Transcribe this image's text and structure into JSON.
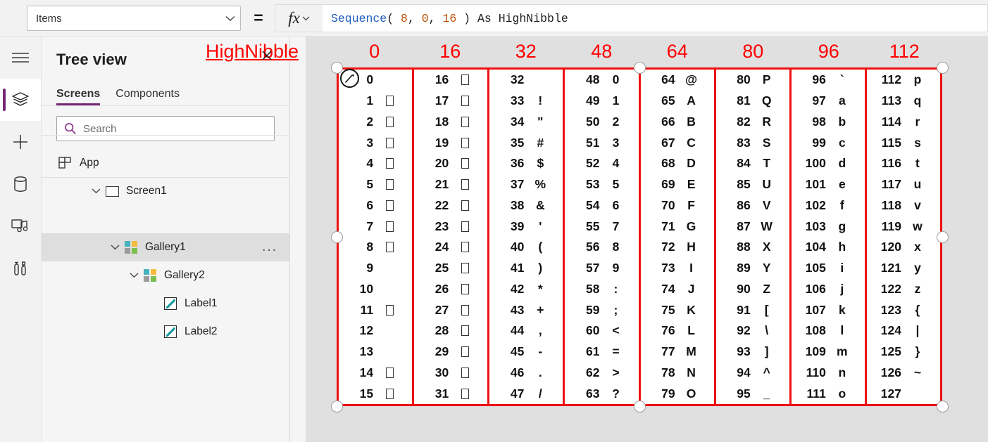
{
  "formula_bar": {
    "property_value": "Items",
    "equals": "=",
    "fx_label": "fx",
    "formula_tokens": [
      {
        "text": "Sequence",
        "kind": "fn"
      },
      {
        "text": "( ",
        "kind": "p"
      },
      {
        "text": "8",
        "kind": "num"
      },
      {
        "text": ", ",
        "kind": "p"
      },
      {
        "text": "0",
        "kind": "num"
      },
      {
        "text": ", ",
        "kind": "p"
      },
      {
        "text": "16",
        "kind": "num"
      },
      {
        "text": " ) ",
        "kind": "p"
      },
      {
        "text": "As HighNibble",
        "kind": "id"
      }
    ],
    "formula_plain": "Sequence( 8, 0, 16 ) As HighNibble"
  },
  "rail": {
    "items": [
      {
        "name": "hamburger-menu-icon",
        "label": "Menu",
        "active": false
      },
      {
        "name": "tree-view-layers-icon",
        "label": "Tree view",
        "active": true
      },
      {
        "name": "insert-plus-icon",
        "label": "Insert",
        "active": false
      },
      {
        "name": "data-cylinder-icon",
        "label": "Data",
        "active": false
      },
      {
        "name": "media-icon",
        "label": "Media",
        "active": false
      },
      {
        "name": "advanced-tools-icon",
        "label": "Advanced tools",
        "active": false
      }
    ]
  },
  "tree_panel": {
    "title": "Tree view",
    "tabs": [
      {
        "label": "Screens",
        "selected": true
      },
      {
        "label": "Components",
        "selected": false
      }
    ],
    "search": {
      "placeholder": "Search",
      "value": "",
      "icon": "search-icon"
    },
    "rows": [
      {
        "label": "App",
        "icon": "app-icon",
        "indent": 0,
        "twisty": "",
        "selected": false,
        "menu": false
      },
      {
        "label": "Screen1",
        "icon": "screen-icon",
        "indent": 0,
        "twisty": "chevron-down-icon",
        "selected": false,
        "menu": false
      },
      {
        "label": "Gallery1",
        "icon": "gallery-icon",
        "indent": 1,
        "twisty": "chevron-down-icon",
        "selected": true,
        "menu": true,
        "menu_label": "..."
      },
      {
        "label": "Gallery2",
        "icon": "gallery-icon",
        "indent": 2,
        "twisty": "chevron-down-icon",
        "selected": false,
        "menu": false
      },
      {
        "label": "Label1",
        "icon": "label-icon",
        "indent": 3,
        "twisty": "",
        "selected": false,
        "menu": false
      },
      {
        "label": "Label2",
        "icon": "label-icon",
        "indent": 3,
        "twisty": "",
        "selected": false,
        "menu": false
      }
    ]
  },
  "canvas": {
    "accent_red": "#ff0000",
    "selection_border": "#ee1111",
    "high_nibble_label": "HighNibble",
    "column_headers": [
      "0",
      "16",
      "32",
      "48",
      "64",
      "80",
      "96",
      "112"
    ],
    "columns": [
      {
        "header": "0",
        "cells": [
          {
            "n": "0",
            "glyph": "",
            "box": false
          },
          {
            "n": "1",
            "glyph": "",
            "box": true
          },
          {
            "n": "2",
            "glyph": "",
            "box": true
          },
          {
            "n": "3",
            "glyph": "",
            "box": true
          },
          {
            "n": "4",
            "glyph": "",
            "box": true
          },
          {
            "n": "5",
            "glyph": "",
            "box": true
          },
          {
            "n": "6",
            "glyph": "",
            "box": true
          },
          {
            "n": "7",
            "glyph": "",
            "box": true
          },
          {
            "n": "8",
            "glyph": "",
            "box": true
          },
          {
            "n": "9",
            "glyph": "",
            "box": false
          },
          {
            "n": "10",
            "glyph": "",
            "box": false
          },
          {
            "n": "11",
            "glyph": "",
            "box": true
          },
          {
            "n": "12",
            "glyph": "",
            "box": false
          },
          {
            "n": "13",
            "glyph": "",
            "box": false
          },
          {
            "n": "14",
            "glyph": "",
            "box": true
          },
          {
            "n": "15",
            "glyph": "",
            "box": true
          }
        ]
      },
      {
        "header": "16",
        "cells": [
          {
            "n": "16",
            "glyph": "",
            "box": true
          },
          {
            "n": "17",
            "glyph": "",
            "box": true
          },
          {
            "n": "18",
            "glyph": "",
            "box": true
          },
          {
            "n": "19",
            "glyph": "",
            "box": true
          },
          {
            "n": "20",
            "glyph": "",
            "box": true
          },
          {
            "n": "21",
            "glyph": "",
            "box": true
          },
          {
            "n": "22",
            "glyph": "",
            "box": true
          },
          {
            "n": "23",
            "glyph": "",
            "box": true
          },
          {
            "n": "24",
            "glyph": "",
            "box": true
          },
          {
            "n": "25",
            "glyph": "",
            "box": true
          },
          {
            "n": "26",
            "glyph": "",
            "box": true
          },
          {
            "n": "27",
            "glyph": "",
            "box": true
          },
          {
            "n": "28",
            "glyph": "",
            "box": true
          },
          {
            "n": "29",
            "glyph": "",
            "box": true
          },
          {
            "n": "30",
            "glyph": "",
            "box": true
          },
          {
            "n": "31",
            "glyph": "",
            "box": true
          }
        ]
      },
      {
        "header": "32",
        "cells": [
          {
            "n": "32",
            "glyph": "",
            "box": false
          },
          {
            "n": "33",
            "glyph": "!",
            "box": false
          },
          {
            "n": "34",
            "glyph": "\"",
            "box": false
          },
          {
            "n": "35",
            "glyph": "#",
            "box": false
          },
          {
            "n": "36",
            "glyph": "$",
            "box": false
          },
          {
            "n": "37",
            "glyph": "%",
            "box": false
          },
          {
            "n": "38",
            "glyph": "&",
            "box": false
          },
          {
            "n": "39",
            "glyph": "'",
            "box": false
          },
          {
            "n": "40",
            "glyph": "(",
            "box": false
          },
          {
            "n": "41",
            "glyph": ")",
            "box": false
          },
          {
            "n": "42",
            "glyph": "*",
            "box": false
          },
          {
            "n": "43",
            "glyph": "+",
            "box": false
          },
          {
            "n": "44",
            "glyph": ",",
            "box": false
          },
          {
            "n": "45",
            "glyph": "-",
            "box": false
          },
          {
            "n": "46",
            "glyph": ".",
            "box": false
          },
          {
            "n": "47",
            "glyph": "/",
            "box": false
          }
        ]
      },
      {
        "header": "48",
        "cells": [
          {
            "n": "48",
            "glyph": "0",
            "box": false
          },
          {
            "n": "49",
            "glyph": "1",
            "box": false
          },
          {
            "n": "50",
            "glyph": "2",
            "box": false
          },
          {
            "n": "51",
            "glyph": "3",
            "box": false
          },
          {
            "n": "52",
            "glyph": "4",
            "box": false
          },
          {
            "n": "53",
            "glyph": "5",
            "box": false
          },
          {
            "n": "54",
            "glyph": "6",
            "box": false
          },
          {
            "n": "55",
            "glyph": "7",
            "box": false
          },
          {
            "n": "56",
            "glyph": "8",
            "box": false
          },
          {
            "n": "57",
            "glyph": "9",
            "box": false
          },
          {
            "n": "58",
            "glyph": ":",
            "box": false
          },
          {
            "n": "59",
            "glyph": ";",
            "box": false
          },
          {
            "n": "60",
            "glyph": "<",
            "box": false
          },
          {
            "n": "61",
            "glyph": "=",
            "box": false
          },
          {
            "n": "62",
            "glyph": ">",
            "box": false
          },
          {
            "n": "63",
            "glyph": "?",
            "box": false
          }
        ]
      },
      {
        "header": "64",
        "cells": [
          {
            "n": "64",
            "glyph": "@",
            "box": false
          },
          {
            "n": "65",
            "glyph": "A",
            "box": false
          },
          {
            "n": "66",
            "glyph": "B",
            "box": false
          },
          {
            "n": "67",
            "glyph": "C",
            "box": false
          },
          {
            "n": "68",
            "glyph": "D",
            "box": false
          },
          {
            "n": "69",
            "glyph": "E",
            "box": false
          },
          {
            "n": "70",
            "glyph": "F",
            "box": false
          },
          {
            "n": "71",
            "glyph": "G",
            "box": false
          },
          {
            "n": "72",
            "glyph": "H",
            "box": false
          },
          {
            "n": "73",
            "glyph": "I",
            "box": false
          },
          {
            "n": "74",
            "glyph": "J",
            "box": false
          },
          {
            "n": "75",
            "glyph": "K",
            "box": false
          },
          {
            "n": "76",
            "glyph": "L",
            "box": false
          },
          {
            "n": "77",
            "glyph": "M",
            "box": false
          },
          {
            "n": "78",
            "glyph": "N",
            "box": false
          },
          {
            "n": "79",
            "glyph": "O",
            "box": false
          }
        ]
      },
      {
        "header": "80",
        "cells": [
          {
            "n": "80",
            "glyph": "P",
            "box": false
          },
          {
            "n": "81",
            "glyph": "Q",
            "box": false
          },
          {
            "n": "82",
            "glyph": "R",
            "box": false
          },
          {
            "n": "83",
            "glyph": "S",
            "box": false
          },
          {
            "n": "84",
            "glyph": "T",
            "box": false
          },
          {
            "n": "85",
            "glyph": "U",
            "box": false
          },
          {
            "n": "86",
            "glyph": "V",
            "box": false
          },
          {
            "n": "87",
            "glyph": "W",
            "box": false
          },
          {
            "n": "88",
            "glyph": "X",
            "box": false
          },
          {
            "n": "89",
            "glyph": "Y",
            "box": false
          },
          {
            "n": "90",
            "glyph": "Z",
            "box": false
          },
          {
            "n": "91",
            "glyph": "[",
            "box": false
          },
          {
            "n": "92",
            "glyph": "\\",
            "box": false
          },
          {
            "n": "93",
            "glyph": "]",
            "box": false
          },
          {
            "n": "94",
            "glyph": "^",
            "box": false
          },
          {
            "n": "95",
            "glyph": "_",
            "box": false
          }
        ]
      },
      {
        "header": "96",
        "cells": [
          {
            "n": "96",
            "glyph": "`",
            "box": false
          },
          {
            "n": "97",
            "glyph": "a",
            "box": false
          },
          {
            "n": "98",
            "glyph": "b",
            "box": false
          },
          {
            "n": "99",
            "glyph": "c",
            "box": false
          },
          {
            "n": "100",
            "glyph": "d",
            "box": false
          },
          {
            "n": "101",
            "glyph": "e",
            "box": false
          },
          {
            "n": "102",
            "glyph": "f",
            "box": false
          },
          {
            "n": "103",
            "glyph": "g",
            "box": false
          },
          {
            "n": "104",
            "glyph": "h",
            "box": false
          },
          {
            "n": "105",
            "glyph": "i",
            "box": false
          },
          {
            "n": "106",
            "glyph": "j",
            "box": false
          },
          {
            "n": "107",
            "glyph": "k",
            "box": false
          },
          {
            "n": "108",
            "glyph": "l",
            "box": false
          },
          {
            "n": "109",
            "glyph": "m",
            "box": false
          },
          {
            "n": "110",
            "glyph": "n",
            "box": false
          },
          {
            "n": "111",
            "glyph": "o",
            "box": false
          }
        ]
      },
      {
        "header": "112",
        "cells": [
          {
            "n": "112",
            "glyph": "p",
            "box": false
          },
          {
            "n": "113",
            "glyph": "q",
            "box": false
          },
          {
            "n": "114",
            "glyph": "r",
            "box": false
          },
          {
            "n": "115",
            "glyph": "s",
            "box": false
          },
          {
            "n": "116",
            "glyph": "t",
            "box": false
          },
          {
            "n": "117",
            "glyph": "u",
            "box": false
          },
          {
            "n": "118",
            "glyph": "v",
            "box": false
          },
          {
            "n": "119",
            "glyph": "w",
            "box": false
          },
          {
            "n": "120",
            "glyph": "x",
            "box": false
          },
          {
            "n": "121",
            "glyph": "y",
            "box": false
          },
          {
            "n": "122",
            "glyph": "z",
            "box": false
          },
          {
            "n": "123",
            "glyph": "{",
            "box": false
          },
          {
            "n": "124",
            "glyph": "|",
            "box": false
          },
          {
            "n": "125",
            "glyph": "}",
            "box": false
          },
          {
            "n": "126",
            "glyph": "~",
            "box": false
          },
          {
            "n": "127",
            "glyph": "",
            "box": false
          }
        ]
      }
    ]
  }
}
